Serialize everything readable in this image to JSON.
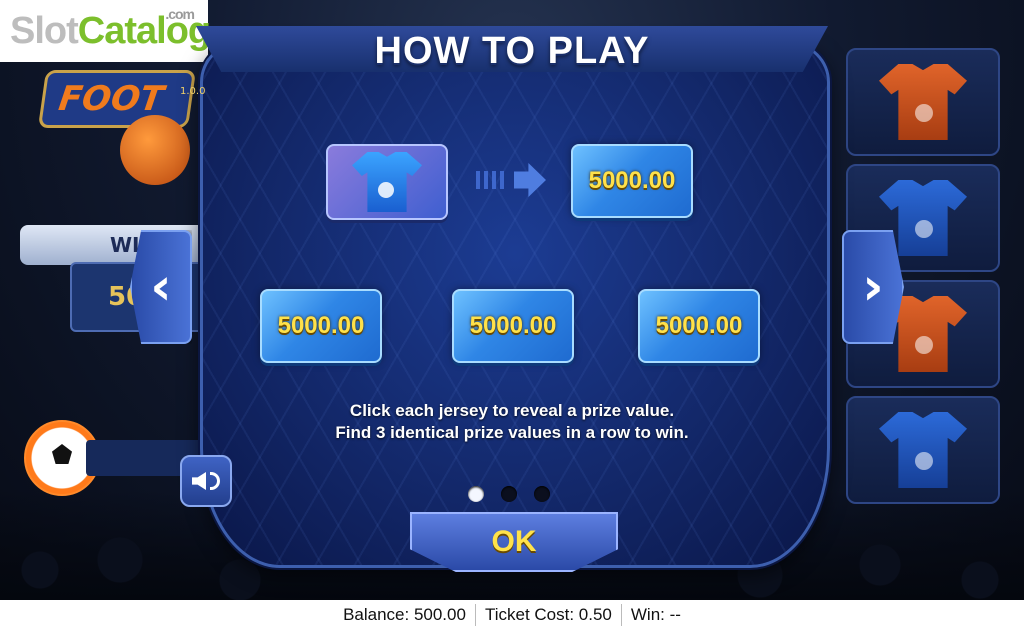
{
  "watermark": {
    "slot": "Slot",
    "catalog": "Catalog",
    "com": ".com"
  },
  "background": {
    "logo_text": "FOOT",
    "win_bar_text": "WI  T",
    "win_value": "50  00"
  },
  "modal": {
    "title": "HOW TO PLAY",
    "version": "1.0.0",
    "example_prize": "5000.00",
    "row_prizes": [
      "5000.00",
      "5000.00",
      "5000.00"
    ],
    "instruction_line1": "Click each jersey to reveal a prize value.",
    "instruction_line2": "Find 3 identical prize values in a row to win.",
    "ok_label": "OK",
    "page_dots": {
      "count": 3,
      "active": 1
    }
  },
  "colors": {
    "prize_text": "#ffe14a",
    "ok_text": "#ffe24a"
  },
  "status": {
    "balance_label": "Balance: 500.00",
    "ticket_label": "Ticket Cost: 0.50",
    "win_label": "Win: --"
  }
}
